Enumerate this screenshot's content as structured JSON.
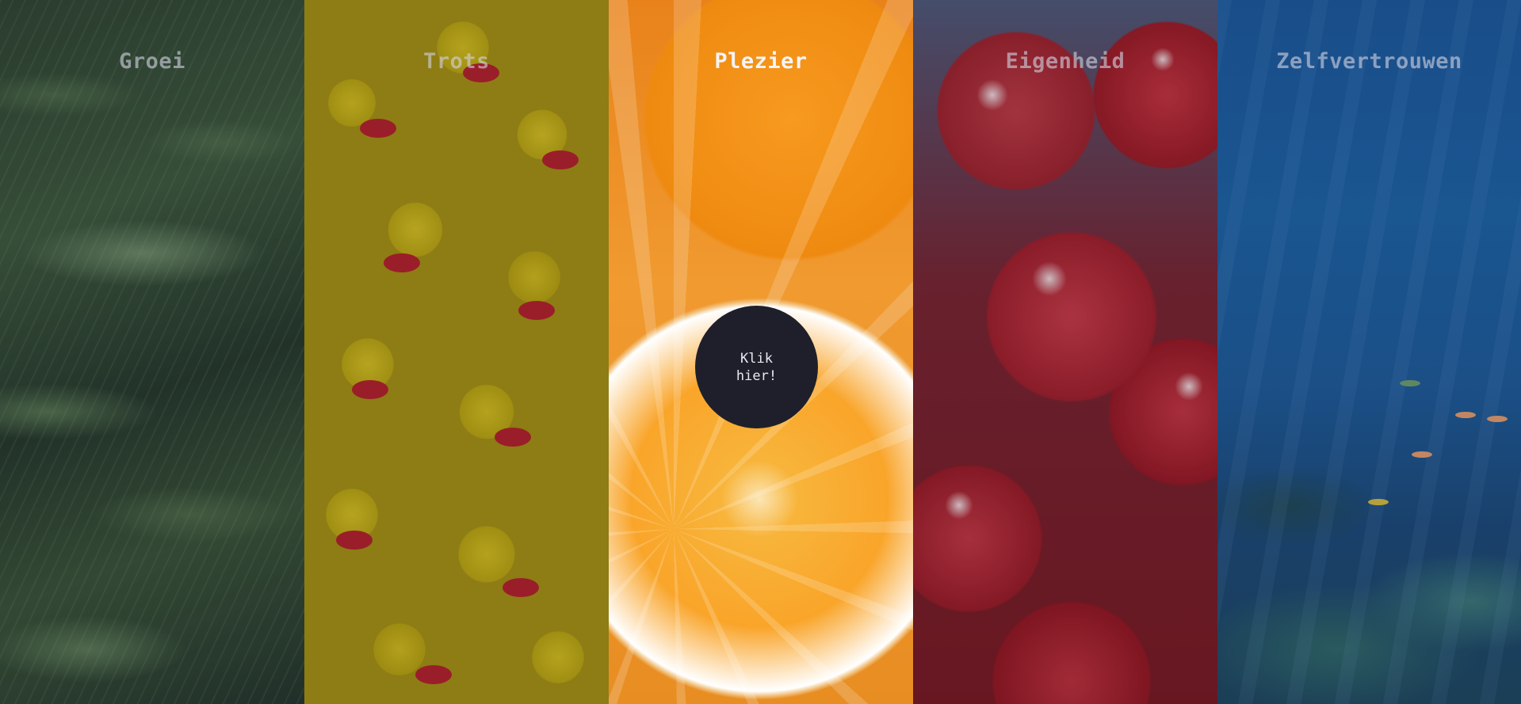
{
  "panels": [
    {
      "id": "groei",
      "title": "Groei",
      "active": false,
      "image": "palm-leaves"
    },
    {
      "id": "trots",
      "title": "Trots",
      "active": false,
      "image": "rubber-ducks"
    },
    {
      "id": "plezier",
      "title": "Plezier",
      "active": true,
      "image": "oranges"
    },
    {
      "id": "eigenheid",
      "title": "Eigenheid",
      "active": false,
      "image": "red-balloons"
    },
    {
      "id": "zelfvertrouwen",
      "title": "Zelfvertrouwen",
      "active": false,
      "image": "coral-reef"
    }
  ],
  "cta": {
    "label": "Klik\nhier!"
  },
  "colors": {
    "button_bg": "#1e1f2a",
    "button_text": "#e8e8ee",
    "title_active": "#f4f4f6",
    "title_inactive": "#a9a9bd"
  }
}
